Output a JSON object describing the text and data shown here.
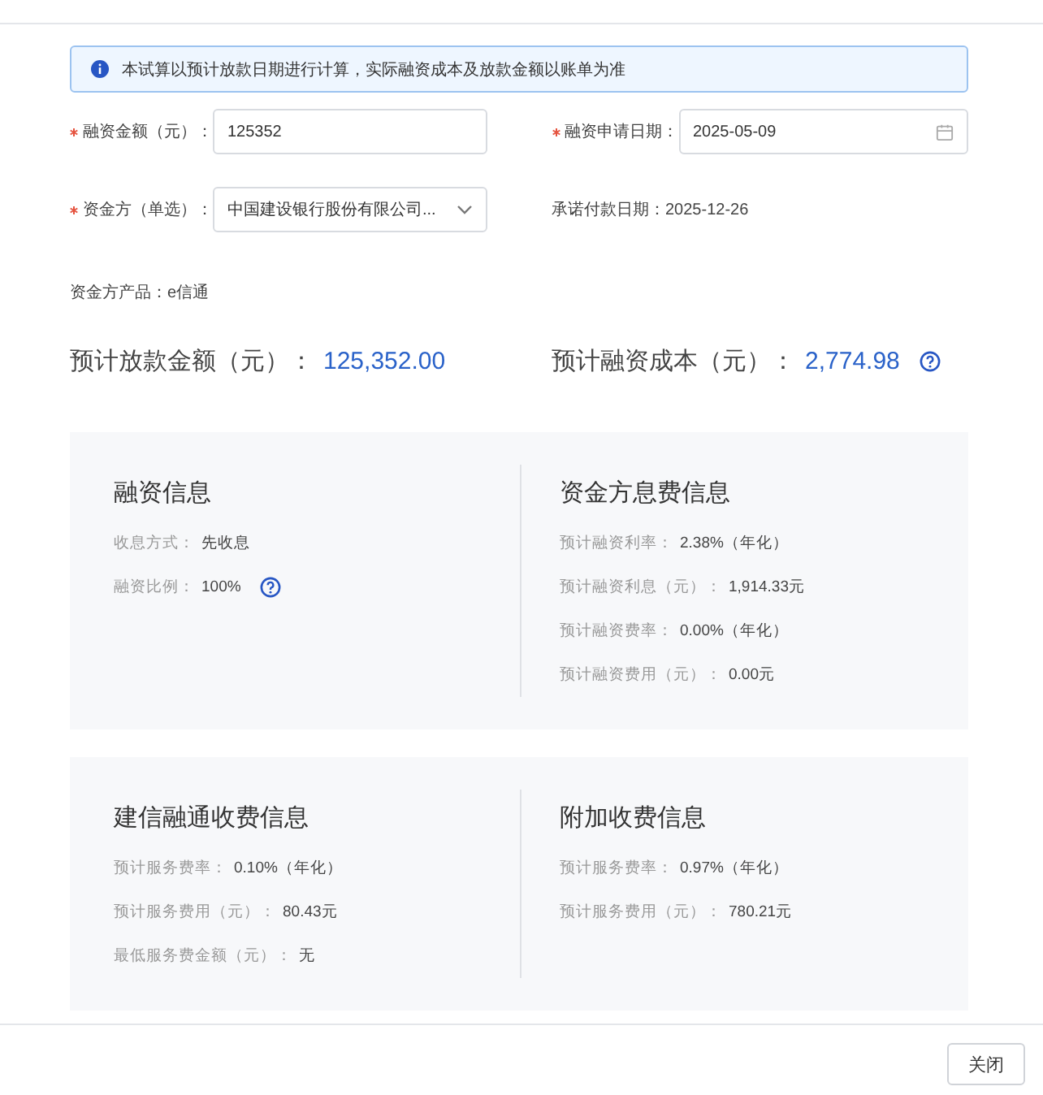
{
  "notice": "本试算以预计放款日期进行计算，实际融资成本及放款金额以账单为准",
  "form": [
    {
      "label": "融资金额（元）：",
      "required": true,
      "kind": "text",
      "value": "125352"
    },
    {
      "label": "融资申请日期：",
      "required": true,
      "kind": "date",
      "value": "2025-05-09"
    },
    {
      "label": "资金方（单选）：",
      "required": true,
      "kind": "select",
      "value": "中国建设银行股份有限公司..."
    },
    {
      "label": "承诺付款日期：",
      "required": false,
      "kind": "static",
      "value": "2025-12-26"
    }
  ],
  "product": "资金方产品：e信通",
  "summary": [
    {
      "label": "预计放款金额（元）：",
      "value": "125,352.00",
      "help": false
    },
    {
      "label": "预计融资成本（元）：",
      "value": "2,774.98",
      "help": true
    }
  ],
  "panels": [
    {
      "sections": [
        {
          "title": "融资信息",
          "items": [
            {
              "label": "收息方式：",
              "value": "先收息",
              "help": false
            },
            {
              "label": "融资比例：",
              "value": "100%",
              "help": true
            }
          ]
        },
        {
          "title": "资金方息费信息",
          "items": [
            {
              "label": "预计融资利率：",
              "value": "2.38%（年化）",
              "help": false
            },
            {
              "label": "预计融资利息（元）：",
              "value": "1,914.33元",
              "help": false
            },
            {
              "label": "预计融资费率：",
              "value": "0.00%（年化）",
              "help": false
            },
            {
              "label": "预计融资费用（元）：",
              "value": "0.00元",
              "help": false
            }
          ]
        }
      ]
    },
    {
      "sections": [
        {
          "title": "建信融通收费信息",
          "items": [
            {
              "label": "预计服务费率：",
              "value": "0.10%（年化）",
              "help": false
            },
            {
              "label": "预计服务费用（元）：",
              "value": "80.43元",
              "help": false
            },
            {
              "label": "最低服务费金额（元）：",
              "value": "无",
              "help": false
            }
          ]
        },
        {
          "title": "附加收费信息",
          "items": [
            {
              "label": "预计服务费率：",
              "value": "0.97%（年化）",
              "help": false
            },
            {
              "label": "预计服务费用（元）：",
              "value": "780.21元",
              "help": false
            }
          ]
        }
      ]
    }
  ],
  "buttons": [
    "关闭"
  ]
}
